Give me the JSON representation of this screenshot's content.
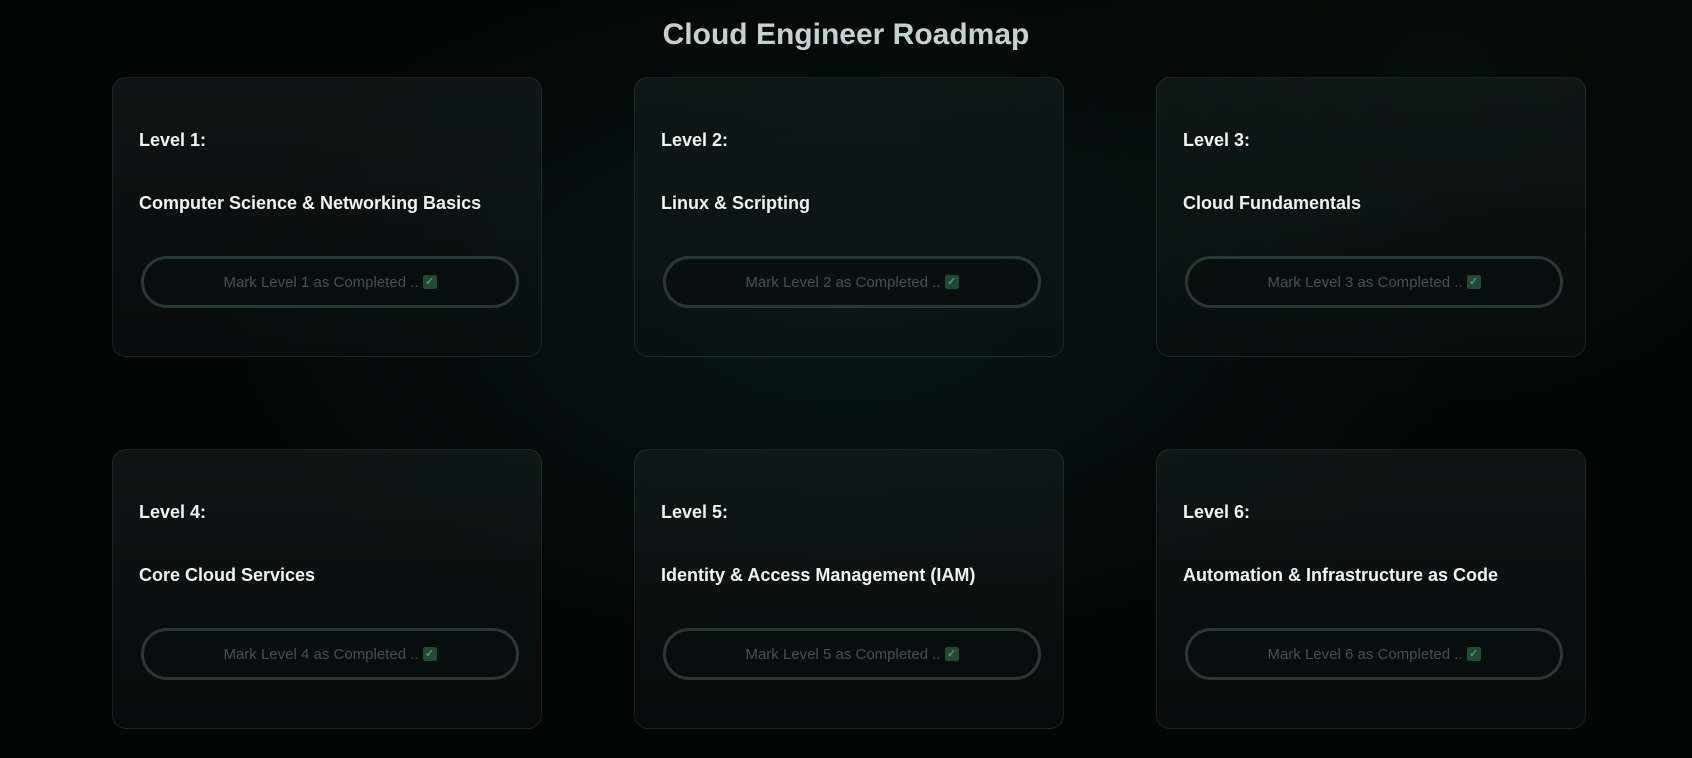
{
  "page": {
    "title": "Cloud Engineer Roadmap"
  },
  "levels": [
    {
      "label": "Level 1:",
      "title": "Computer Science & Networking Basics",
      "button": "Mark Level 1 as Completed ..",
      "check_icon": "check-box-icon"
    },
    {
      "label": "Level 2:",
      "title": "Linux & Scripting",
      "button": "Mark Level 2 as Completed ..",
      "check_icon": "check-box-icon"
    },
    {
      "label": "Level 3:",
      "title": "Cloud Fundamentals",
      "button": "Mark Level 3 as Completed ..",
      "check_icon": "check-box-icon"
    },
    {
      "label": "Level 4:",
      "title": "Core Cloud Services",
      "button": "Mark Level 4 as Completed ..",
      "check_icon": "check-box-icon"
    },
    {
      "label": "Level 5:",
      "title": "Identity & Access Management (IAM)",
      "button": "Mark Level 5 as Completed ..",
      "check_icon": "check-box-icon"
    },
    {
      "label": "Level 6:",
      "title": "Automation & Infrastructure as Code",
      "button": "Mark Level 6 as Completed ..",
      "check_icon": "check-box-icon"
    }
  ],
  "colors": {
    "background": "#030605",
    "title_text": "#c4d2cf",
    "card_text": "#f1f4f3",
    "button_text": "#3f5452",
    "button_border": "#2a3835",
    "check_fill": "#1f4a34"
  }
}
